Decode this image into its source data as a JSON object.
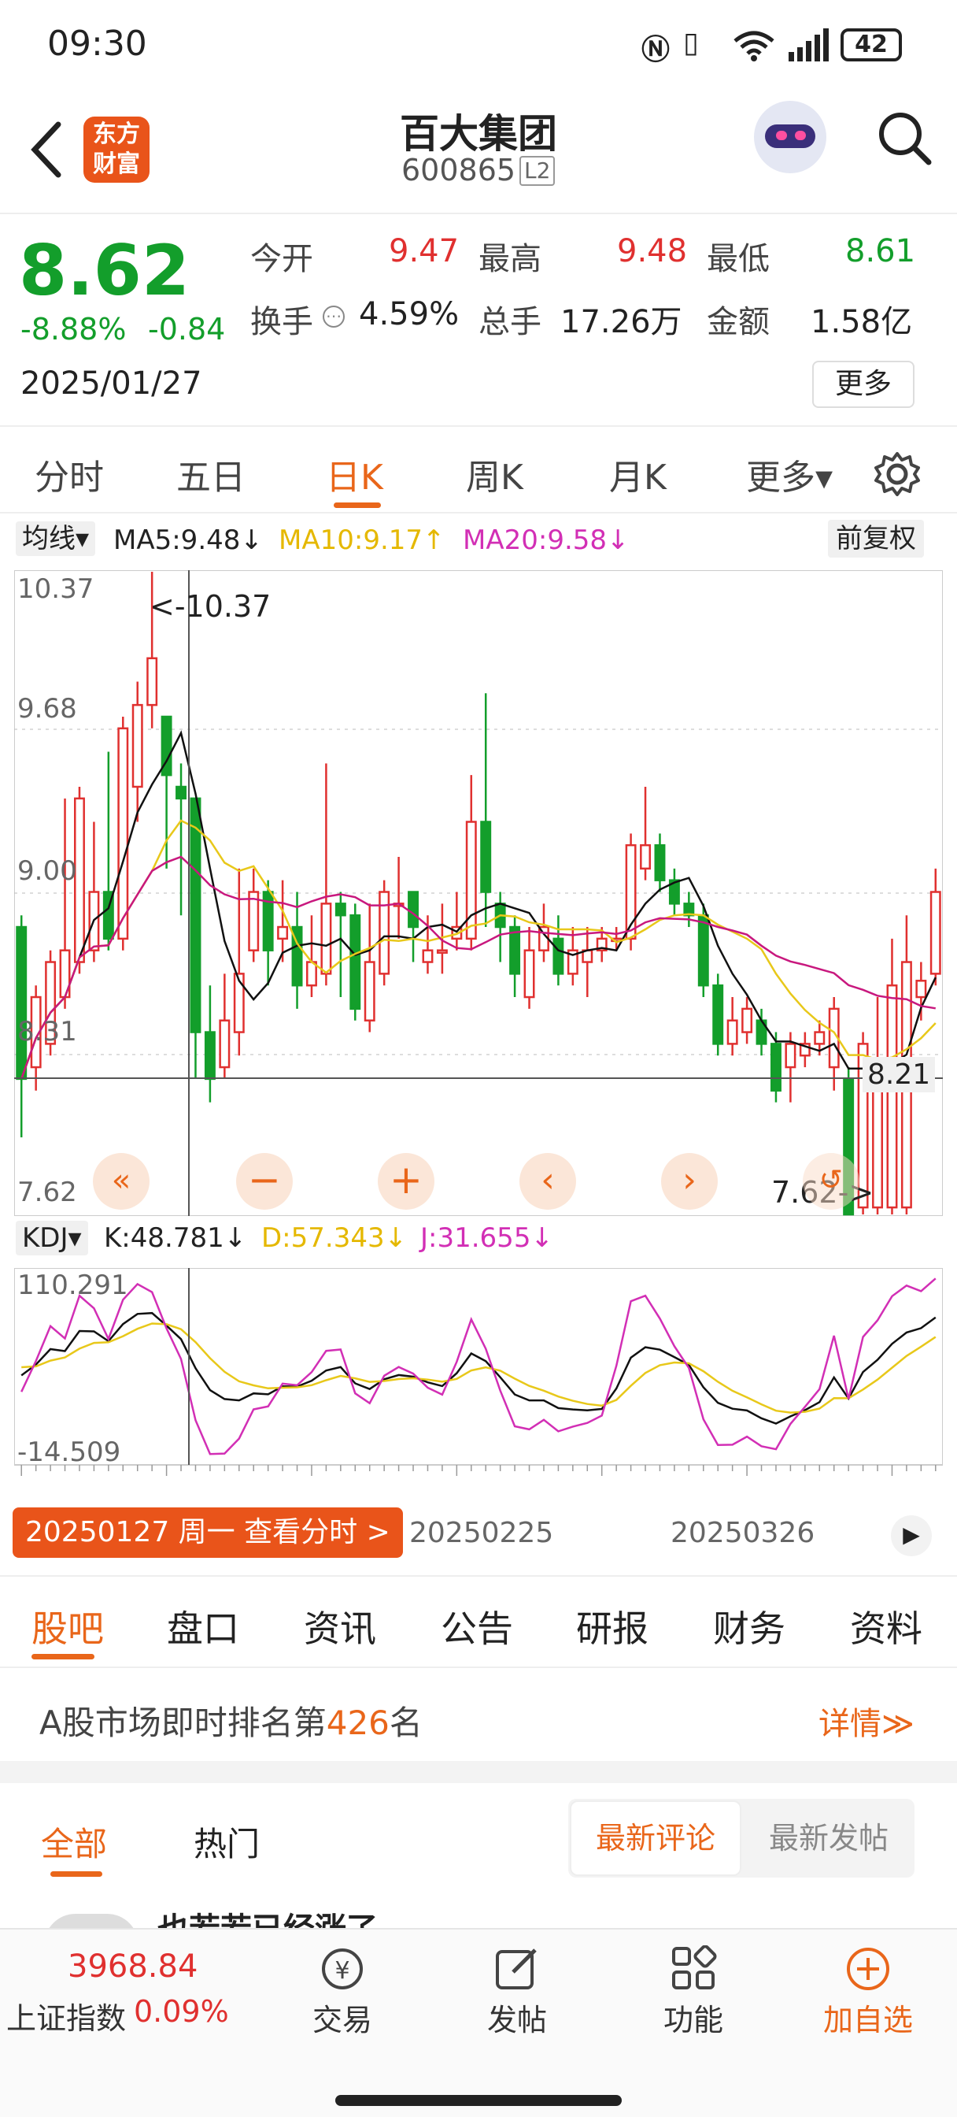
{
  "status": {
    "time": "09:30",
    "battery": "42"
  },
  "header": {
    "logo_line1": "东方",
    "logo_line2": "财富",
    "title": "百大集团",
    "code": "600865",
    "level": "L2"
  },
  "quote": {
    "price": "8.62",
    "change_pct": "-8.88%",
    "change": "-0.84",
    "date": "2025/01/27",
    "open_label": "今开",
    "open": "9.47",
    "high_label": "最高",
    "high": "9.48",
    "low_label": "最低",
    "low": "8.61",
    "turnover_label": "换手",
    "turnover": "4.59%",
    "volume_label": "总手",
    "volume": "17.26万",
    "amount_label": "金额",
    "amount": "1.58亿",
    "more": "更多"
  },
  "tabs": [
    "分时",
    "五日",
    "日K",
    "周K",
    "月K",
    "更多▾"
  ],
  "active_tab": "日K",
  "ma_bar": {
    "select": "均线▾",
    "ma5": "MA5:9.48↓",
    "ma10": "MA10:9.17↑",
    "ma20": "MA20:9.58↓",
    "adjust": "前复权"
  },
  "price_axis": {
    "l1": "10.37",
    "l2": "9.68",
    "l3": "9.00",
    "l4": "8.31",
    "l5": "7.62",
    "max_marker": "<-10.37",
    "min_marker": "7.62->",
    "cross_price": "8.21"
  },
  "kdj_bar": {
    "select": "KDJ▾",
    "k": "K:48.781↓",
    "d": "D:57.343↓",
    "j": "J:31.655↓"
  },
  "kdj_axis": {
    "top": "110.291",
    "bottom": "-14.509"
  },
  "date_axis": {
    "d1": "20250225",
    "d2": "20250326"
  },
  "date_popup": "20250127 周一 查看分时 >",
  "bottom_tabs": [
    "股吧",
    "盘口",
    "资讯",
    "公告",
    "研报",
    "财务",
    "资料"
  ],
  "rank": {
    "prefix": "A股市场即时排名第",
    "num": "426",
    "suffix": "名",
    "detail": "详情≫"
  },
  "feed": {
    "all": "全部",
    "hot": "热门",
    "latest_comment": "最新评论",
    "latest_post": "最新发帖",
    "preview": "也若若已经涨了"
  },
  "nav": {
    "index_value": "3968.84",
    "index_name": "上证指数",
    "index_pct": "0.09%",
    "trade": "交易",
    "post": "发帖",
    "func": "功能",
    "add": "加自选"
  },
  "chart_data": {
    "type": "candlestick",
    "candles": [
      {
        "o": 8.85,
        "c": 8.2,
        "h": 8.9,
        "l": 7.95
      },
      {
        "o": 8.25,
        "c": 8.55,
        "h": 8.6,
        "l": 8.15
      },
      {
        "o": 8.35,
        "c": 8.7,
        "h": 8.75,
        "l": 8.3
      },
      {
        "o": 8.55,
        "c": 8.75,
        "h": 9.4,
        "l": 8.5
      },
      {
        "o": 8.7,
        "c": 9.4,
        "h": 9.45,
        "l": 8.65
      },
      {
        "o": 8.75,
        "c": 9.0,
        "h": 9.3,
        "l": 8.7
      },
      {
        "o": 9.0,
        "c": 8.8,
        "h": 9.6,
        "l": 8.75
      },
      {
        "o": 8.8,
        "c": 9.7,
        "h": 9.75,
        "l": 8.75
      },
      {
        "o": 9.45,
        "c": 9.8,
        "h": 9.9,
        "l": 9.3
      },
      {
        "o": 9.8,
        "c": 10.0,
        "h": 10.37,
        "l": 9.7
      },
      {
        "o": 9.75,
        "c": 9.5,
        "h": 9.75,
        "l": 9.1
      },
      {
        "o": 9.45,
        "c": 9.4,
        "h": 9.55,
        "l": 8.9
      },
      {
        "o": 9.4,
        "c": 8.4,
        "h": 9.4,
        "l": 8.2
      },
      {
        "o": 8.4,
        "c": 8.2,
        "h": 8.6,
        "l": 8.1
      },
      {
        "o": 8.25,
        "c": 8.45,
        "h": 8.65,
        "l": 8.2
      },
      {
        "o": 8.4,
        "c": 8.65,
        "h": 9.1,
        "l": 8.3
      },
      {
        "o": 8.75,
        "c": 9.0,
        "h": 9.1,
        "l": 8.7
      },
      {
        "o": 9.0,
        "c": 8.75,
        "h": 9.05,
        "l": 8.6
      },
      {
        "o": 8.8,
        "c": 8.85,
        "h": 9.05,
        "l": 8.7
      },
      {
        "o": 8.85,
        "c": 8.6,
        "h": 9.0,
        "l": 8.5
      },
      {
        "o": 8.6,
        "c": 8.7,
        "h": 8.9,
        "l": 8.55
      },
      {
        "o": 8.65,
        "c": 8.95,
        "h": 9.55,
        "l": 8.6
      },
      {
        "o": 8.95,
        "c": 8.9,
        "h": 9.0,
        "l": 8.55
      },
      {
        "o": 8.9,
        "c": 8.5,
        "h": 8.95,
        "l": 8.45
      },
      {
        "o": 8.45,
        "c": 8.7,
        "h": 8.95,
        "l": 8.4
      },
      {
        "o": 8.65,
        "c": 9.0,
        "h": 9.05,
        "l": 8.6
      },
      {
        "o": 8.95,
        "c": 8.95,
        "h": 9.15,
        "l": 8.8
      },
      {
        "o": 9.0,
        "c": 8.85,
        "h": 9.0,
        "l": 8.7
      },
      {
        "o": 8.7,
        "c": 8.75,
        "h": 8.9,
        "l": 8.65
      },
      {
        "o": 8.75,
        "c": 8.75,
        "h": 8.95,
        "l": 8.65
      },
      {
        "o": 8.8,
        "c": 8.85,
        "h": 9.0,
        "l": 8.75
      },
      {
        "o": 8.8,
        "c": 9.3,
        "h": 9.5,
        "l": 8.75
      },
      {
        "o": 9.3,
        "c": 9.0,
        "h": 9.85,
        "l": 8.85
      },
      {
        "o": 8.95,
        "c": 8.85,
        "h": 9.0,
        "l": 8.7
      },
      {
        "o": 8.85,
        "c": 8.65,
        "h": 8.9,
        "l": 8.55
      },
      {
        "o": 8.55,
        "c": 8.75,
        "h": 8.85,
        "l": 8.5
      },
      {
        "o": 8.75,
        "c": 8.85,
        "h": 8.95,
        "l": 8.7
      },
      {
        "o": 8.8,
        "c": 8.65,
        "h": 8.9,
        "l": 8.6
      },
      {
        "o": 8.65,
        "c": 8.75,
        "h": 8.85,
        "l": 8.6
      },
      {
        "o": 8.7,
        "c": 8.75,
        "h": 8.85,
        "l": 8.55
      },
      {
        "o": 8.75,
        "c": 8.8,
        "h": 8.85,
        "l": 8.7
      },
      {
        "o": 8.8,
        "c": 8.8,
        "h": 8.85,
        "l": 8.75
      },
      {
        "o": 8.8,
        "c": 9.2,
        "h": 9.25,
        "l": 8.75
      },
      {
        "o": 9.1,
        "c": 9.2,
        "h": 9.45,
        "l": 9.05
      },
      {
        "o": 9.2,
        "c": 9.05,
        "h": 9.25,
        "l": 9.0
      },
      {
        "o": 9.05,
        "c": 8.95,
        "h": 9.1,
        "l": 8.9
      },
      {
        "o": 8.95,
        "c": 8.9,
        "h": 9.0,
        "l": 8.85
      },
      {
        "o": 8.9,
        "c": 8.6,
        "h": 8.95,
        "l": 8.55
      },
      {
        "o": 8.6,
        "c": 8.35,
        "h": 8.65,
        "l": 8.3
      },
      {
        "o": 8.35,
        "c": 8.45,
        "h": 8.55,
        "l": 8.3
      },
      {
        "o": 8.4,
        "c": 8.5,
        "h": 8.55,
        "l": 8.35
      },
      {
        "o": 8.45,
        "c": 8.35,
        "h": 8.5,
        "l": 8.3
      },
      {
        "o": 8.35,
        "c": 8.15,
        "h": 8.4,
        "l": 8.1
      },
      {
        "o": 8.25,
        "c": 8.35,
        "h": 8.4,
        "l": 8.1
      },
      {
        "o": 8.3,
        "c": 8.35,
        "h": 8.4,
        "l": 8.25
      },
      {
        "o": 8.35,
        "c": 8.4,
        "h": 8.45,
        "l": 8.3
      },
      {
        "o": 8.25,
        "c": 8.5,
        "h": 8.55,
        "l": 8.15
      },
      {
        "o": 8.2,
        "c": 7.62,
        "h": 8.25,
        "l": 7.62
      },
      {
        "o": 7.65,
        "c": 8.35,
        "h": 8.4,
        "l": 7.62
      },
      {
        "o": 7.65,
        "c": 8.25,
        "h": 8.55,
        "l": 7.62
      },
      {
        "o": 7.65,
        "c": 8.6,
        "h": 8.8,
        "l": 7.62
      },
      {
        "o": 7.65,
        "c": 8.7,
        "h": 8.9,
        "l": 7.62
      },
      {
        "o": 8.55,
        "c": 8.62,
        "h": 8.7,
        "l": 8.45
      },
      {
        "o": 8.65,
        "c": 9.0,
        "h": 9.1,
        "l": 8.6
      }
    ],
    "ylim": [
      7.62,
      10.37
    ],
    "kdj_ylim": [
      -14.509,
      110.291
    ]
  },
  "colors": {
    "up": "#e0302f",
    "down": "#139e2b",
    "accent": "#e9661a",
    "ma5": "#111111",
    "ma10": "#e8c81a",
    "ma20": "#c8187e"
  }
}
